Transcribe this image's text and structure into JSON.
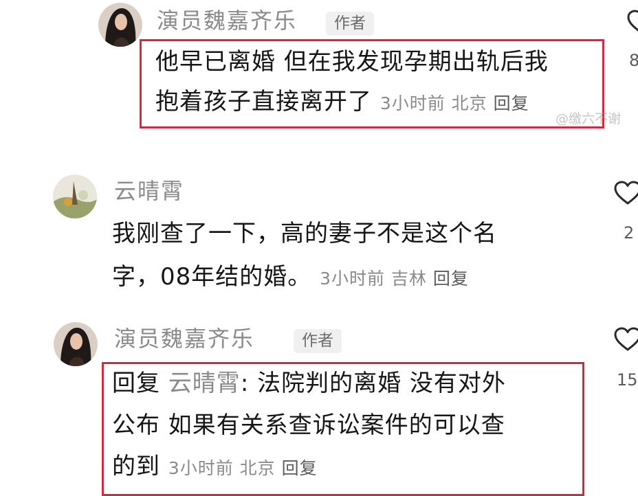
{
  "comments": [
    {
      "author": "演员魏嘉齐乐",
      "badge": "作者",
      "lines": [
        "他早已离婚  但在我发现孕期出轨后我",
        "抱着孩子直接离开了"
      ],
      "time": "3小时前",
      "location": "北京",
      "reply_label": "回复",
      "like_count": "8"
    },
    {
      "author": "云晴霄",
      "lines": [
        "我刚查了一下，高的妻子不是这个名",
        "字，08年结的婚。"
      ],
      "time": "3小时前",
      "location": "吉林",
      "reply_label": "回复",
      "like_count": "2"
    },
    {
      "author": "演员魏嘉齐乐",
      "badge": "作者",
      "reply_prefix": "回复",
      "reply_to": "云晴霄",
      "lines": [
        ": 法院判的离婚 没有对外",
        "公布  如果有关系查诉讼案件的可以查",
        "的到"
      ],
      "time": "3小时前",
      "location": "北京",
      "reply_label": "回复",
      "like_count": "15"
    }
  ],
  "watermark": "@缴六不谢",
  "icons": {
    "like": "heart-outline-icon"
  },
  "colors": {
    "highlight": "#d9263b",
    "meta": "#8a8a8a"
  }
}
